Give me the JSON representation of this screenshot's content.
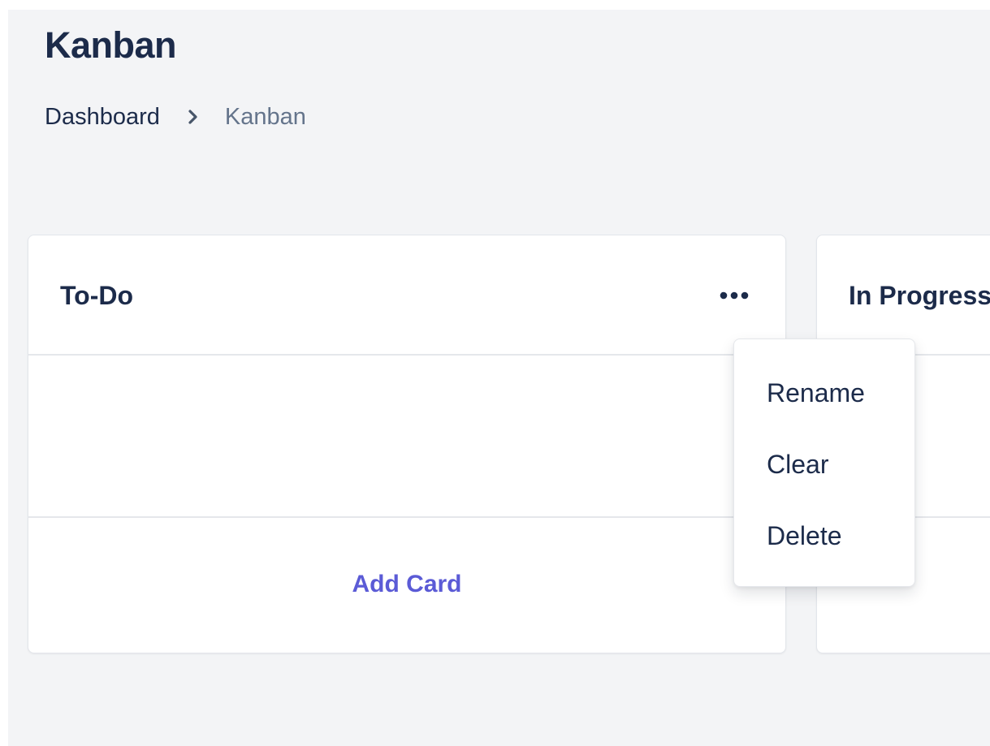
{
  "page": {
    "title": "Kanban"
  },
  "breadcrumb": {
    "items": [
      {
        "label": "Dashboard"
      },
      {
        "label": "Kanban"
      }
    ],
    "separator_icon": "chevron-right-icon"
  },
  "columns": [
    {
      "title": "To-Do",
      "menu_icon": "ellipsis-horizontal-icon",
      "add_card_label": "Add Card"
    },
    {
      "title": "In Progress"
    }
  ],
  "column_menu": {
    "items": [
      {
        "label": "Rename"
      },
      {
        "label": "Clear"
      },
      {
        "label": "Delete"
      }
    ]
  },
  "colors": {
    "background": "#f3f4f6",
    "text_primary": "#1c2b4a",
    "text_muted": "#64748b",
    "accent": "#5b5bd6",
    "card": "#ffffff",
    "border": "#e5e7eb"
  }
}
